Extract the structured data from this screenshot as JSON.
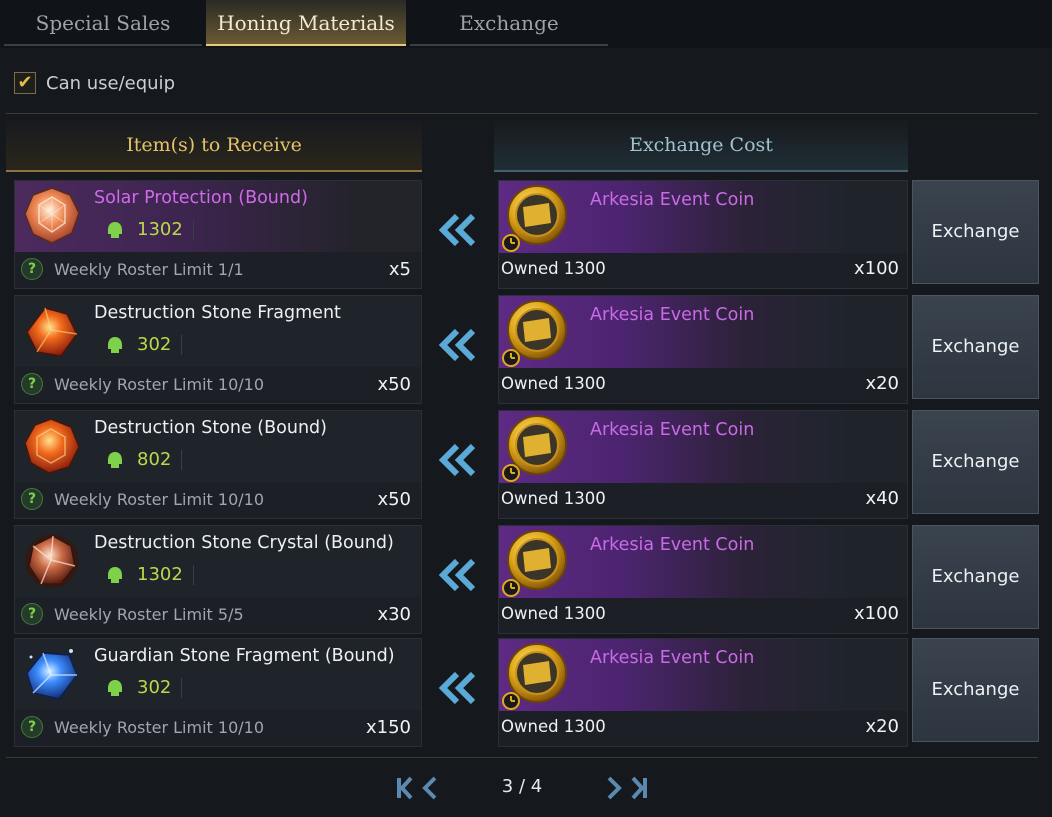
{
  "tabs": [
    {
      "label": "Special Sales",
      "active": false
    },
    {
      "label": "Honing Materials",
      "active": true
    },
    {
      "label": "Exchange",
      "active": false
    }
  ],
  "filter": {
    "label": "Can use/equip",
    "checked": true
  },
  "headers": {
    "left": "Item(s) to Receive",
    "right": "Exchange Cost"
  },
  "rows": [
    {
      "item": {
        "name": "Solar Protection (Bound)",
        "level": "1302",
        "limit": "Weekly Roster Limit 1/1",
        "qty": "x5",
        "icon": "solar-protection-icon",
        "highlight": true
      },
      "cost": {
        "name": "Arkesia Event Coin",
        "owned": "Owned 1300",
        "qty": "x100",
        "icon": "arkesia-event-coin-icon"
      },
      "button": "Exchange"
    },
    {
      "item": {
        "name": "Destruction Stone Fragment",
        "level": "302",
        "limit": "Weekly Roster Limit 10/10",
        "qty": "x50",
        "icon": "destruction-stone-fragment-icon",
        "highlight": false
      },
      "cost": {
        "name": "Arkesia Event Coin",
        "owned": "Owned 1300",
        "qty": "x20",
        "icon": "arkesia-event-coin-icon"
      },
      "button": "Exchange"
    },
    {
      "item": {
        "name": "Destruction Stone (Bound)",
        "level": "802",
        "limit": "Weekly Roster Limit 10/10",
        "qty": "x50",
        "icon": "destruction-stone-icon",
        "highlight": false
      },
      "cost": {
        "name": "Arkesia Event Coin",
        "owned": "Owned 1300",
        "qty": "x40",
        "icon": "arkesia-event-coin-icon"
      },
      "button": "Exchange"
    },
    {
      "item": {
        "name": "Destruction Stone Crystal (Bound)",
        "level": "1302",
        "limit": "Weekly Roster Limit 5/5",
        "qty": "x30",
        "icon": "destruction-stone-crystal-icon",
        "highlight": false
      },
      "cost": {
        "name": "Arkesia Event Coin",
        "owned": "Owned 1300",
        "qty": "x100",
        "icon": "arkesia-event-coin-icon"
      },
      "button": "Exchange"
    },
    {
      "item": {
        "name": "Guardian Stone Fragment (Bound)",
        "level": "302",
        "limit": "Weekly Roster Limit 10/10",
        "qty": "x150",
        "icon": "guardian-stone-fragment-icon",
        "highlight": false
      },
      "cost": {
        "name": "Arkesia Event Coin",
        "owned": "Owned 1300",
        "qty": "x20",
        "icon": "arkesia-event-coin-icon"
      },
      "button": "Exchange"
    }
  ],
  "pagination": {
    "text": "3 / 4"
  },
  "colors": {
    "accent_gold": "#e8c97a",
    "purple_name": "#cf6be8",
    "level_green": "#b9d94a",
    "arrow_blue": "#5aa9d6"
  }
}
